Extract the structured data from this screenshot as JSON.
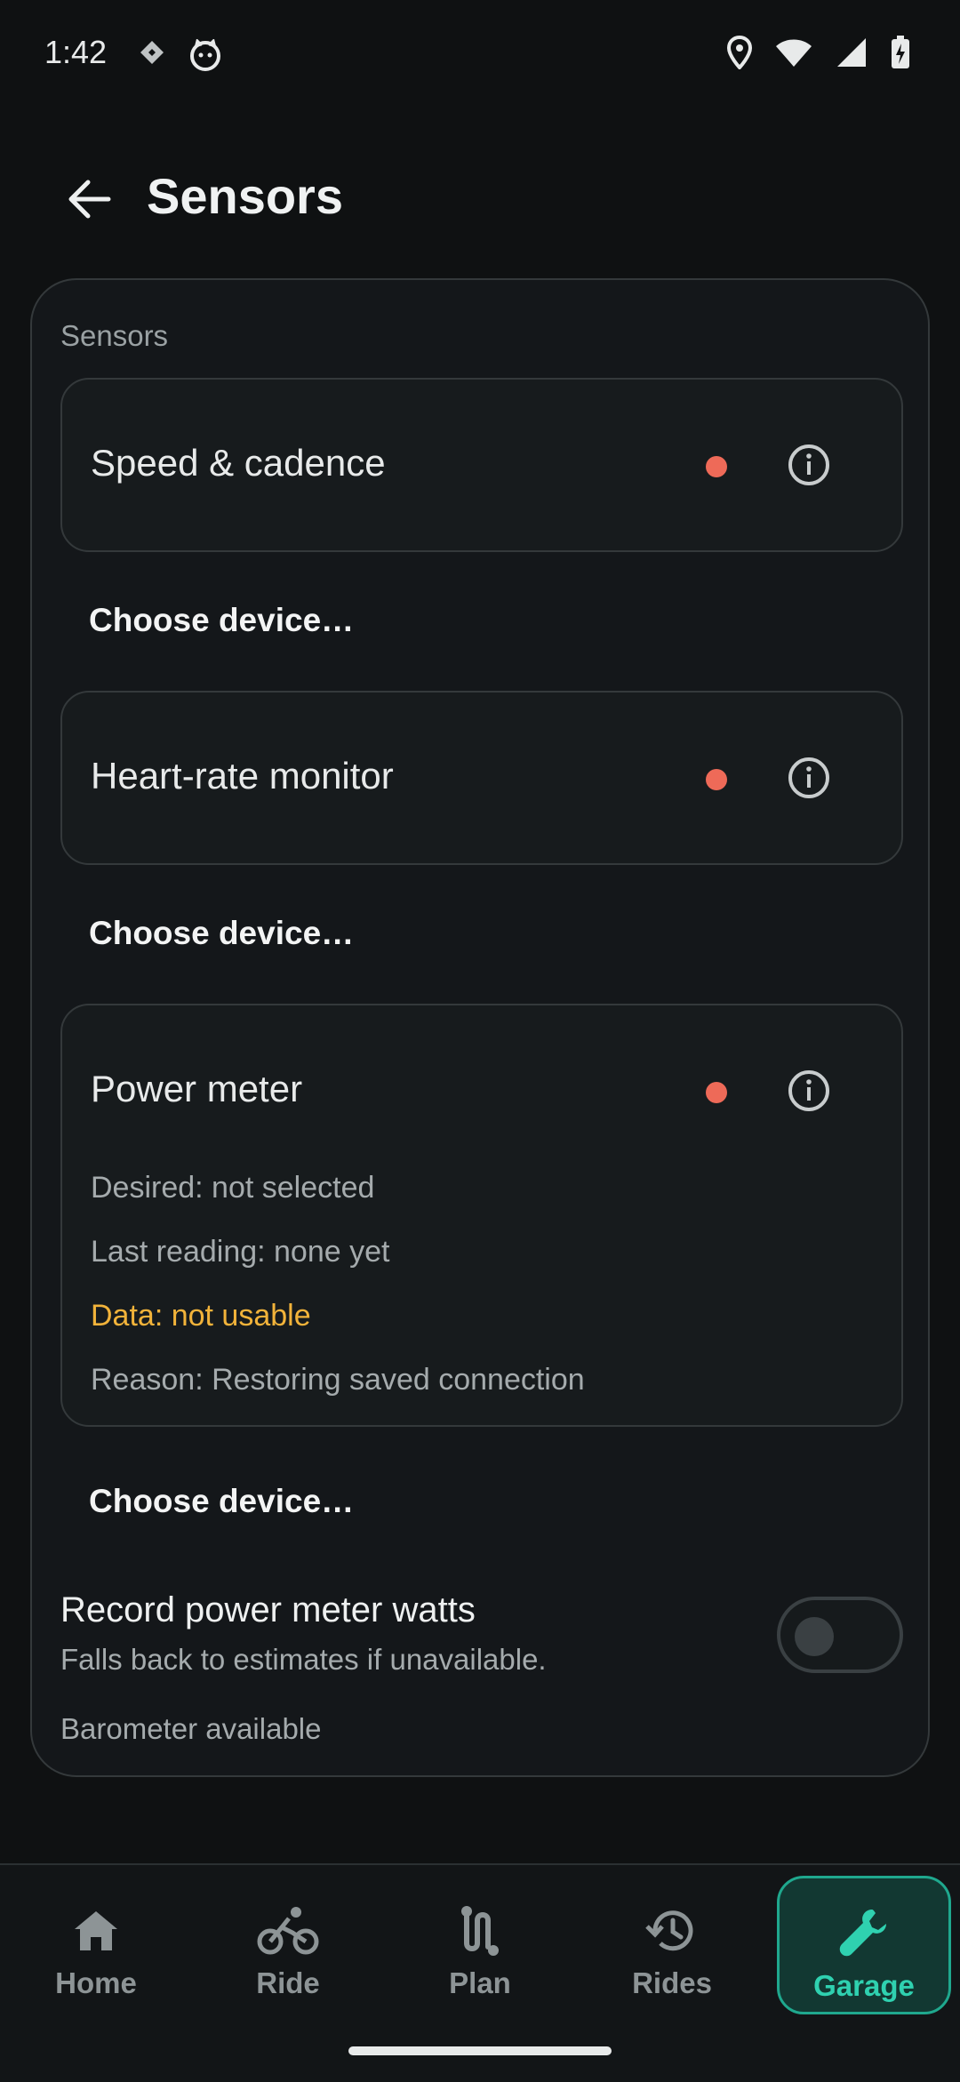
{
  "status_bar": {
    "time": "1:42",
    "left_icons": [
      "diamond-icon",
      "cat-face-icon"
    ],
    "right_icons": [
      "location-icon",
      "wifi-icon",
      "signal-icon",
      "battery-charging-icon"
    ]
  },
  "app_bar": {
    "back_icon": "arrow-left-icon",
    "title": "Sensors"
  },
  "panel": {
    "label": "Sensors",
    "sensors": [
      {
        "name": "Speed & cadence",
        "status_color": "#ee6a58",
        "choose_label": "Choose device…"
      },
      {
        "name": "Heart-rate monitor",
        "status_color": "#ee6a58",
        "choose_label": "Choose device…"
      },
      {
        "name": "Power meter",
        "status_color": "#ee6a58",
        "details": {
          "desired": "Desired: not selected",
          "last_reading": "Last reading: none yet",
          "data": "Data: not usable",
          "reason": "Reason: Restoring saved connection"
        },
        "choose_label": "Choose device…"
      }
    ],
    "record_power": {
      "title": "Record power meter watts",
      "subtitle": "Falls back to estimates if unavailable.",
      "enabled": false
    },
    "barometer": "Barometer available"
  },
  "bottom_nav": {
    "items": [
      {
        "label": "Home",
        "icon": "home-icon",
        "active": false
      },
      {
        "label": "Ride",
        "icon": "bicycle-icon",
        "active": false
      },
      {
        "label": "Plan",
        "icon": "route-icon",
        "active": false
      },
      {
        "label": "Rides",
        "icon": "history-icon",
        "active": false
      },
      {
        "label": "Garage",
        "icon": "wrench-icon",
        "active": true
      }
    ]
  },
  "colors": {
    "background": "#0f1112",
    "accent": "#2fd1b0",
    "status_disconnected": "#ee6a58",
    "warning": "#f2b33a"
  }
}
